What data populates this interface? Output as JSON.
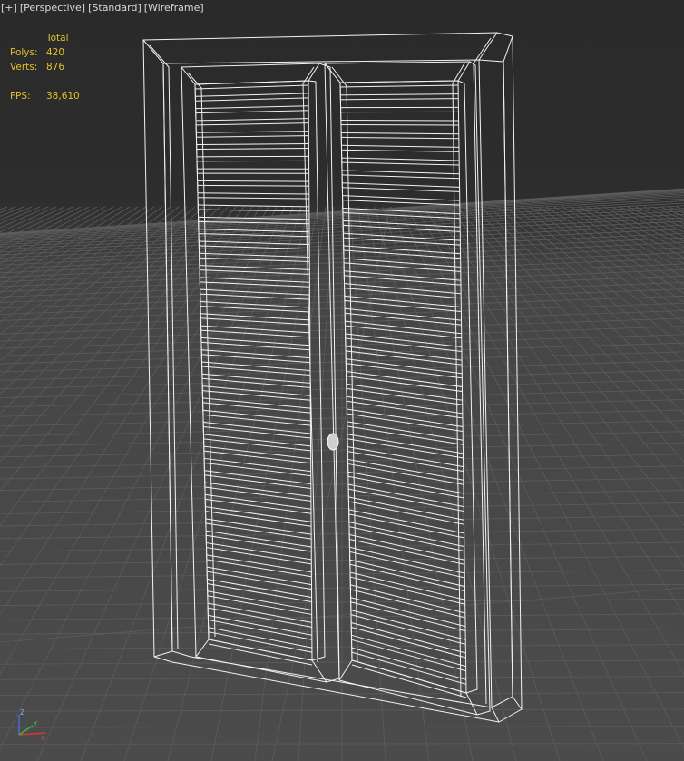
{
  "viewport_menu": {
    "plus": "[+]",
    "view": "[Perspective]",
    "shading_style": "[Standard]",
    "render_mode": "[Wireframe]"
  },
  "stats": {
    "header": "Total",
    "polys_label": "Polys:",
    "polys_value": "420",
    "verts_label": "Verts:",
    "verts_value": "876",
    "fps_label": "FPS:",
    "fps_value": "38,610"
  },
  "axis_gizmo": {
    "z": "Z",
    "x": "X",
    "y": "Y"
  },
  "colors": {
    "stats_text": "#e0c22c",
    "wireframe": "#ffffff",
    "grid": "#5c5c5c",
    "background": "#2b2b2b",
    "axis_x": "#d03a3a",
    "axis_y": "#3ab83a",
    "axis_z": "#4a6ad8"
  }
}
